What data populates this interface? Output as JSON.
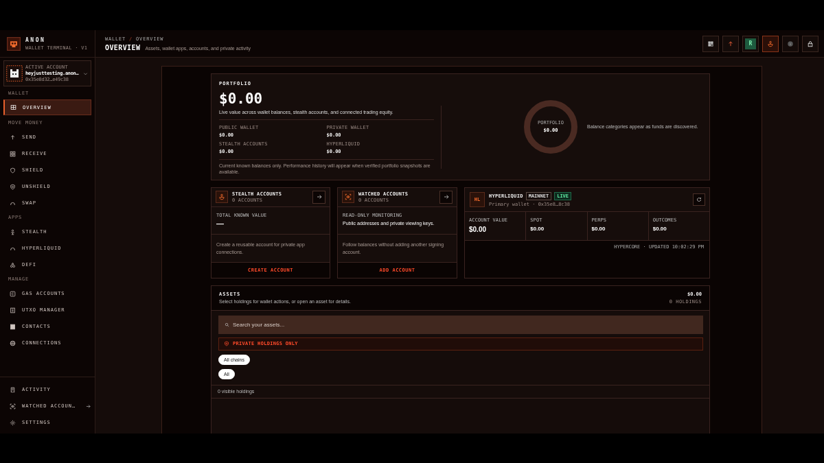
{
  "brand": {
    "name": "ANON",
    "subtitle": "WALLET TERMINAL · V1"
  },
  "account": {
    "label": "ACTIVE ACCOUNT",
    "name": "heyjusttesting.anon…",
    "address": "0x35e8d32…e49c38"
  },
  "sidebar": {
    "sections": [
      {
        "heading": "WALLET",
        "items": [
          {
            "label": "OVERVIEW",
            "selected": true
          }
        ]
      },
      {
        "heading": "MOVE MONEY",
        "items": [
          {
            "label": "SEND",
            "selected": false
          },
          {
            "label": "RECEIVE",
            "selected": false
          },
          {
            "label": "SHIELD",
            "selected": false
          },
          {
            "label": "UNSHIELD",
            "selected": false
          },
          {
            "label": "SWAP",
            "selected": false
          }
        ]
      },
      {
        "heading": "APPS",
        "items": [
          {
            "label": "STEALTH",
            "selected": false
          },
          {
            "label": "HYPERLIQUID",
            "selected": false
          },
          {
            "label": "DEFI",
            "selected": false
          }
        ]
      },
      {
        "heading": "MANAGE",
        "items": [
          {
            "label": "GAS ACCOUNTS",
            "selected": false
          },
          {
            "label": "UTXO MANAGER",
            "selected": false
          },
          {
            "label": "CONTACTS",
            "selected": false
          },
          {
            "label": "CONNECTIONS",
            "selected": false
          }
        ]
      }
    ],
    "footer_items": [
      {
        "label": "ACTIVITY",
        "selected": false,
        "trailing_arrow": false
      },
      {
        "label": "WATCHED ACCOUN…",
        "selected": false,
        "trailing_arrow": true
      },
      {
        "label": "SETTINGS",
        "selected": false,
        "trailing_arrow": false
      }
    ]
  },
  "header": {
    "breadcrumb": {
      "items": [
        "WALLET",
        "OVERVIEW"
      ],
      "separator": "/"
    },
    "title": "OVERVIEW",
    "subtitle": "Assets, wallet apps, accounts, and private activity",
    "toolbar": [
      {
        "kind": "icon",
        "selected": false
      },
      {
        "kind": "icon",
        "selected": false
      },
      {
        "kind": "letter",
        "text": "R",
        "selected": false
      },
      {
        "kind": "icon",
        "selected": true
      },
      {
        "kind": "icon",
        "selected": false
      },
      {
        "kind": "icon",
        "selected": false
      }
    ]
  },
  "portfolio": {
    "label": "PORTFOLIO",
    "total": "$0.00",
    "description": "Live value across wallet balances, stealth accounts, and connected trading equity.",
    "balances": [
      {
        "label": "PUBLIC WALLET",
        "value": "$0.00"
      },
      {
        "label": "PRIVATE WALLET",
        "value": "$0.00"
      },
      {
        "label": "STEALTH ACCOUNTS",
        "value": "$0.00"
      },
      {
        "label": "HYPERLIQUID",
        "value": "$0.00"
      }
    ],
    "footnote": "Current known balances only. Performance history will appear when verified portfolio snapshots are available.",
    "donut": {
      "label": "PORTFOLIO",
      "value": "$0.00"
    },
    "legend_note": "Balance categories appear as funds are discovered."
  },
  "account_cards": [
    {
      "title": "STEALTH ACCOUNTS",
      "count": "0 ACCOUNTS",
      "stat_label": "TOTAL KNOWN VALUE",
      "stat_value": "—",
      "description": "Create a reusable account for private app connections.",
      "action": "CREATE ACCOUNT"
    },
    {
      "title": "WATCHED ACCOUNTS",
      "count": "0 ACCOUNTS",
      "stat_label": "READ-ONLY MONITORING",
      "stat_value": "Public addresses and private viewing keys.",
      "description": "Follow balances without adding another signing account.",
      "action": "ADD ACCOUNT"
    }
  ],
  "hyperliquid": {
    "badge": "HL",
    "title": "HYPERLIQUID",
    "tags": [
      {
        "label": "MAINNET",
        "kind": "neutral"
      },
      {
        "label": "LIVE",
        "kind": "live"
      }
    ],
    "subtitle": "Primary wallet · 0x35e8…8c38",
    "metrics": [
      {
        "label": "ACCOUNT VALUE",
        "value": "$0.00"
      },
      {
        "label": "SPOT",
        "value": "$0.00"
      },
      {
        "label": "PERPS",
        "value": "$0.00"
      },
      {
        "label": "OUTCOMES",
        "value": "$0.00"
      }
    ],
    "footer": "HYPERCORE · UPDATED 10:02:29 PM"
  },
  "assets": {
    "title": "ASSETS",
    "subtitle": "Select holdings for wallet actions, or open an asset for details.",
    "total": "$0.00",
    "count": "0 HOLDINGS",
    "search": {
      "placeholder": "Search your assets..."
    },
    "filter_banner": "PRIVATE HOLDINGS ONLY",
    "chain_chips": [
      {
        "label": "All chains",
        "selected": true
      }
    ],
    "type_chips": [
      {
        "label": "All",
        "selected": true
      }
    ],
    "visible_count": "0 visible holdings"
  }
}
